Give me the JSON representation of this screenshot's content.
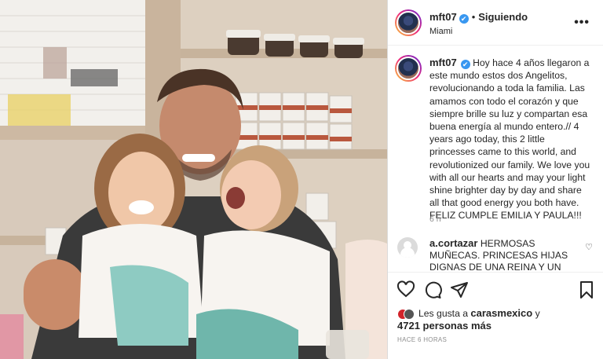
{
  "post": {
    "username": "mft07",
    "verified_mark": "✔",
    "follow_label": "Siguiendo",
    "location": "Miami",
    "more_icon": "•••",
    "caption": "Hoy hace 4 años llegaron a este mundo estos dos Angelitos, revolucionando a toda la familia. Las amamos con todo el corazón y que siempre brille su luz y compartan esa buena energía al mundo entero.// 4 years ago today, this 2 little princesses came to this world, and revolutionized our family. We love you with all our hearts and may your light shine brighter day by day and share all that good energy you both have. FELIZ CUMPLE EMILIA Y PAULA!!!",
    "caption_time": "6 h"
  },
  "comment": {
    "username": "a.cortazar",
    "text": "HERMOSAS MUÑECAS. PRINCESAS HIJAS DIGNAS DE UNA REINA Y UN PRINCIPE XOXO TÚ",
    "heart_icon": "♡"
  },
  "likes": {
    "prefix": "Les gusta a",
    "by_user": "carasmexico",
    "connector": "y",
    "count_text": "4721 personas más"
  },
  "time_ago": "HACE 6 HORAS",
  "icons": [
    "heart-icon",
    "comment-icon",
    "share-icon",
    "bookmark-icon"
  ],
  "colors": {
    "verified": "#3897f0",
    "text": "#262626",
    "muted": "#8e8e8e",
    "border": "#dbdbdb"
  }
}
